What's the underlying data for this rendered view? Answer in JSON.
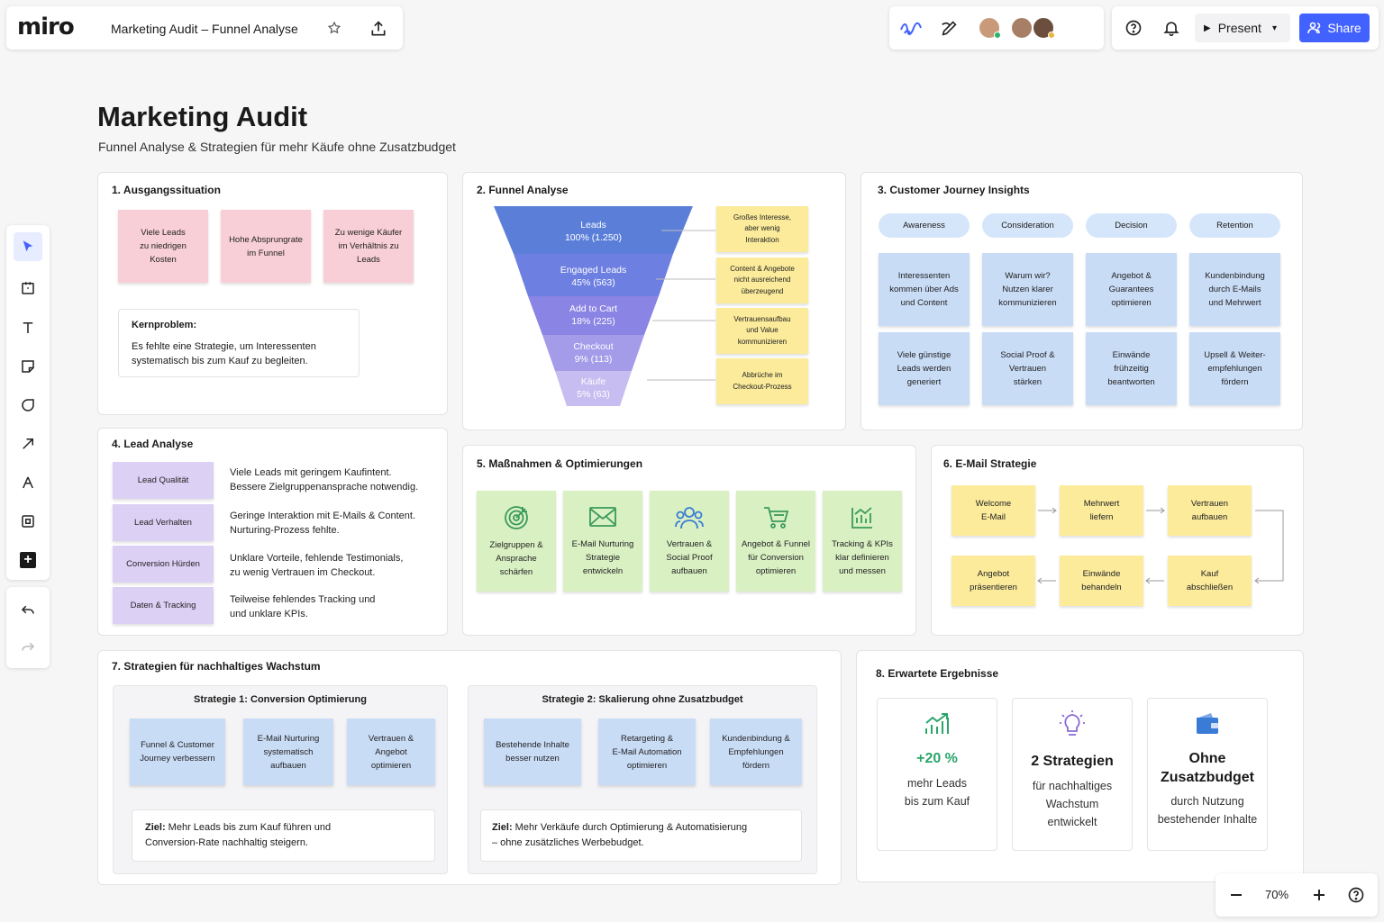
{
  "app": {
    "logo": "miro",
    "board_title": "Marketing Audit – Funnel Analyse"
  },
  "topbar": {
    "present_label": "Present",
    "share_label": "Share"
  },
  "zoom": {
    "level": "70%"
  },
  "header": {
    "title": "Marketing Audit",
    "subtitle": "Funnel Analyse & Strategien für mehr Käufe ohne Zusatzbudget"
  },
  "s1": {
    "title": "1. Ausgangssituation",
    "notes": [
      "Viele Leads\nzu niedrigen\nKosten",
      "Hohe Absprungrate\nim Funnel",
      "Zu wenige Käufer\nim Verhältnis zu\nLeads"
    ],
    "problem_label": "Kernproblem:",
    "problem_text": "Es fehlte eine Strategie, um Interessenten\nsystematisch bis zum Kauf zu begleiten."
  },
  "s2": {
    "title": "2. Funnel Analyse",
    "stages": [
      {
        "name": "Leads",
        "value": "100% (1.250)"
      },
      {
        "name": "Engaged Leads",
        "value": "45% (563)"
      },
      {
        "name": "Add to Cart",
        "value": "18% (225)"
      },
      {
        "name": "Checkout",
        "value": "9% (113)"
      },
      {
        "name": "Käufe",
        "value": "5% (63)"
      }
    ],
    "notes": [
      "Großes Interesse,\naber wenig\nInteraktion",
      "Content & Angebote\nnicht ausreichend\nüberzeugend",
      "Vertrauensaufbau\nund Value\nkommunizieren",
      "Abbrüche im\nCheckout-Prozess"
    ]
  },
  "s3": {
    "title": "3. Customer Journey Insights",
    "phases": [
      "Awareness",
      "Consideration",
      "Decision",
      "Retention"
    ],
    "row1": [
      "Interessenten\nkommen über Ads\nund Content",
      "Warum wir?\nNutzen klarer\nkommunizieren",
      "Angebot &\nGuarantees\noptimieren",
      "Kundenbindung\ndurch E-Mails\nund Mehrwert"
    ],
    "row2": [
      "Viele günstige\nLeads werden\ngeneriert",
      "Social Proof &\nVertrauen\nstärken",
      "Einwände\nfrühzeitig\nbeantworten",
      "Upsell & Weiter-\nempfehlungen\nfördern"
    ]
  },
  "s4": {
    "title": "4. Lead Analyse",
    "rows": [
      {
        "label": "Lead Qualität",
        "text": "Viele Leads mit geringem Kaufintent.\nBessere Zielgruppenansprache notwendig."
      },
      {
        "label": "Lead Verhalten",
        "text": "Geringe Interaktion mit E-Mails & Content.\nNurturing-Prozess fehlte."
      },
      {
        "label": "Conversion Hürden",
        "text": "Unklare Vorteile, fehlende Testimonials,\nzu wenig Vertrauen im Checkout."
      },
      {
        "label": "Daten & Tracking",
        "text": "Teilweise fehlendes Tracking und\nund unklare KPIs."
      }
    ]
  },
  "s5": {
    "title": "5. Maßnahmen & Optimierungen",
    "items": [
      {
        "icon": "target-icon",
        "label": "Zielgruppen &\nAnsprache\nschärfen"
      },
      {
        "icon": "mail-icon",
        "label": "E-Mail Nurturing\nStrategie\nentwickeln"
      },
      {
        "icon": "users-icon",
        "label": "Vertrauen &\nSocial Proof\naufbauen"
      },
      {
        "icon": "cart-icon",
        "label": "Angebot & Funnel\nfür Conversion\noptimieren"
      },
      {
        "icon": "chart-icon",
        "label": "Tracking & KPIs\nklar definieren\nund messen"
      }
    ]
  },
  "s6": {
    "title": "6. E-Mail Strategie",
    "row1": [
      "Welcome\nE-Mail",
      "Mehrwert\nliefern",
      "Vertrauen\naufbauen"
    ],
    "row2": [
      "Angebot\npräsentieren",
      "Einwände\nbehandeln",
      "Kauf\nabschließen"
    ]
  },
  "s7": {
    "title": "7. Strategien für nachhaltiges Wachstum",
    "strategy1": {
      "title": "Strategie 1: Conversion Optimierung",
      "notes": [
        "Funnel & Customer\nJourney verbessern",
        "E-Mail Nurturing\nsystematisch\naufbauen",
        "Vertrauen &\nAngebot\noptimieren"
      ],
      "goal_label": "Ziel:",
      "goal_text": " Mehr Leads bis zum Kauf führen und\nConversion-Rate nachhaltig steigern."
    },
    "strategy2": {
      "title": "Strategie 2: Skalierung ohne Zusatzbudget",
      "notes": [
        "Bestehende Inhalte\nbesser nutzen",
        "Retargeting &\nE-Mail Automation\noptimieren",
        "Kundenbindung &\nEmpfehlungen\nfördern"
      ],
      "goal_label": "Ziel:",
      "goal_text": " Mehr Verkäufe durch Optimierung & Automatisierung\n– ohne zusätzliches Werbebudget."
    }
  },
  "s8": {
    "title": "8. Erwartete Ergebnisse",
    "cards": [
      {
        "icon": "growth-chart-icon",
        "headline": "+20 %",
        "text": "mehr Leads\nbis zum Kauf"
      },
      {
        "icon": "lightbulb-icon",
        "headline": "2 Strategien",
        "text": "für nachhaltiges\nWachstum\nentwickelt"
      },
      {
        "icon": "wallet-icon",
        "headline": "Ohne\nZusatzbudget",
        "text": "durch Nutzung\nbestehender Inhalte"
      }
    ]
  },
  "colors": {
    "share": "#4262ff",
    "growth": "#2aa56a",
    "lightbulb": "#8a6ad6",
    "wallet": "#3a7bd5",
    "funnel_top": "#5b7fd9",
    "funnel_bottom": "#c8bdf0"
  }
}
